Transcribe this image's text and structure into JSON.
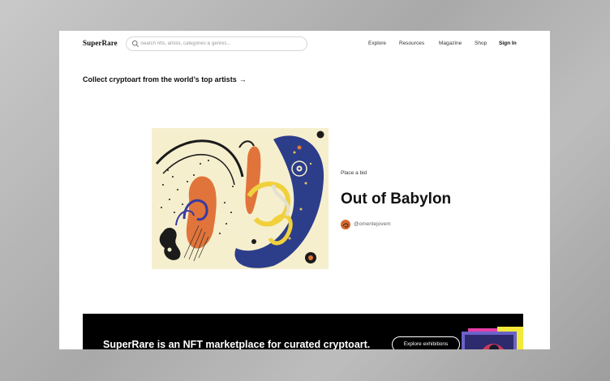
{
  "header": {
    "logo": "SuperRare",
    "search_placeholder": "Search nfts, artists, categories & genres...",
    "nav": [
      "Explore",
      "Resources",
      "Magazine",
      "Shop"
    ],
    "sign_in": "Sign In"
  },
  "hero": {
    "tagline": "Collect cryptoart from the world’s top artists",
    "tagline_arrow": "→"
  },
  "featured": {
    "label": "Place a bid",
    "title": "Out of Babylon",
    "artist": "@omentejovem"
  },
  "banner": {
    "text": "SuperRare is an NFT marketplace for curated cryptoart.",
    "button": "Explore exhibitions"
  },
  "colors": {
    "page_background": "#ffffff",
    "banner_background": "#000000",
    "artwork_background": "#f6efce",
    "artwork_orange": "#e0743a",
    "artwork_navy": "#2c3d8a",
    "artwork_yellow": "#f0d13c",
    "avatar": "#d8692f"
  },
  "icons": {
    "search": "search-icon",
    "tagline_arrow": "arrow-right-icon"
  }
}
